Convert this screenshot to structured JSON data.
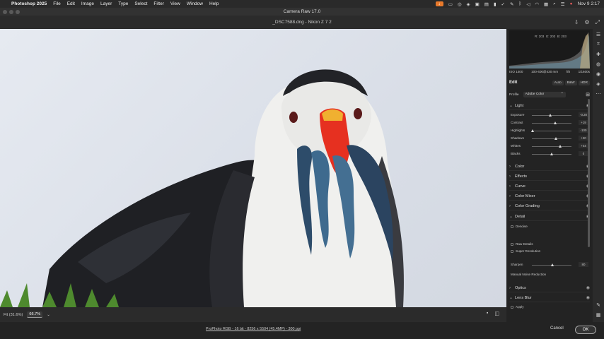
{
  "menubar": {
    "app": "Photoshop 2025",
    "items": [
      "File",
      "Edit",
      "Image",
      "Layer",
      "Type",
      "Select",
      "Filter",
      "View",
      "Window",
      "Help"
    ],
    "clock": "Nov 9  2:17"
  },
  "window": {
    "title": "Camera Raw 17.0"
  },
  "document": {
    "name": "_DSC7588.dng  -  Nikon Z 7 2"
  },
  "histogram": {
    "r_label": "R: 203",
    "g_label": "G: 203",
    "b_label": "B: 203"
  },
  "exif": {
    "iso": "ISO 1400",
    "lens": "100-400@430 mm",
    "aperture": "f/8",
    "shutter": "1/1600s"
  },
  "edit": {
    "title": "Edit",
    "tabs": [
      "Auto",
      "B&W",
      "HDR"
    ],
    "profile_label": "Profile",
    "profile_value": "Adobe Color"
  },
  "light": {
    "title": "Light",
    "sliders": [
      {
        "label": "Exposure",
        "value": "-0.20",
        "pos": 0.47
      },
      {
        "label": "Contrast",
        "value": "+19",
        "pos": 0.6
      },
      {
        "label": "Highlights",
        "value": "-100",
        "pos": 0.02
      },
      {
        "label": "Shadows",
        "value": "+20",
        "pos": 0.62
      },
      {
        "label": "Whites",
        "value": "+44",
        "pos": 0.72
      },
      {
        "label": "Blacks",
        "value": "0",
        "pos": 0.5
      }
    ]
  },
  "sections": {
    "color": "Color",
    "effects": "Effects",
    "curve": "Curve",
    "color_mixer": "Color Mixer",
    "color_grading": "Color Grading",
    "detail": "Detail",
    "optics": "Optics",
    "lens_blur": "Lens Blur"
  },
  "detail": {
    "denoise": "Denoise",
    "raw_details": "Raw Details",
    "super_resolution": "Super Resolution",
    "sharpen_label": "Sharpen",
    "sharpen_value": "80",
    "sharpen_pos": 0.53,
    "manual_noise": "Manual Noise Reduction"
  },
  "lens_blur": {
    "apply": "Apply"
  },
  "bottom": {
    "fit": "Fit (31.6%)",
    "zoom": "66.7%"
  },
  "footer": {
    "info": "ProPhoto RGB - 16 bit - 8256 x 5504 (45.4MP) - 300 ppi",
    "cancel": "Cancel",
    "ok": "OK"
  }
}
